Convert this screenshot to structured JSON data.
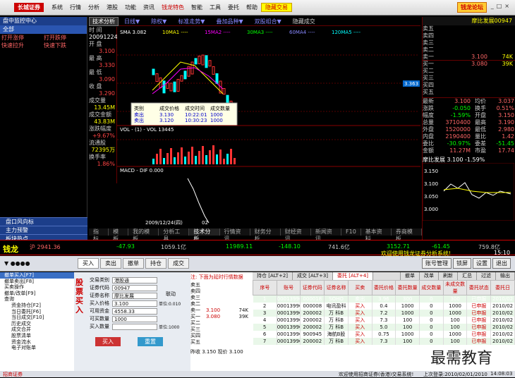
{
  "menu": {
    "logo": "长城证券",
    "items": [
      "系统",
      "行情",
      "分析",
      "港股",
      "功能",
      "资讯",
      "钱龙特色",
      "智能",
      "工具",
      "委托",
      "帮助"
    ],
    "highlight": "隐藏交易",
    "right_btn": "钱龙论坛"
  },
  "left": {
    "header": "盘中监控中心",
    "all": "全部",
    "rows": [
      [
        "打开涨停",
        "打开跌停"
      ],
      [
        "快速拉升",
        "快速下跌"
      ]
    ],
    "sections": [
      "盘口风向标",
      "主力预警",
      "板块热点"
    ]
  },
  "subtab": {
    "title": "技术分析",
    "dropdowns": [
      "日线▼",
      "除权▼",
      "标准走势▼",
      "叠加品种▼",
      "双股组合▼",
      "隐藏成交"
    ]
  },
  "info": {
    "labels": [
      "时 间",
      "开 盘",
      "最 高",
      "最 低",
      "收 盘",
      "成交量",
      "成交金额",
      "涨跌幅度",
      "流通股",
      "换手率"
    ],
    "values": [
      "20091224",
      "3.100",
      "3.330",
      "3.090",
      "3.290",
      "13.45M",
      "43.83M",
      "+9.67%",
      "72395万",
      "1.86%"
    ]
  },
  "chart_data": {
    "type": "line",
    "title": "SMA 3.082",
    "ma_labels": [
      "SMA 3.082",
      "10MA1 ----",
      "15MA2 ----",
      "30MA3 ----",
      "60MA4 ----",
      "120MA5 ----"
    ],
    "y_ticks": [
      "4.000",
      "3.000",
      "2.000",
      "1.000"
    ],
    "vol_title": "VOL - (1) - VOL 13445",
    "vol_ticks": [
      "6000",
      "4000",
      "2000"
    ],
    "macd_title": "MACD - DIF 0.000",
    "macd_ticks": [
      "0.043",
      "0.000",
      "-0.027"
    ],
    "highlight_price": "3.363",
    "tooltip": {
      "headers": [
        "类别",
        "成交价格",
        "成交时间",
        "成交数量"
      ],
      "rows": [
        [
          "卖出",
          "3.130",
          "10:22:01",
          "1000"
        ],
        [
          "卖出",
          "3.120",
          "10:30:23",
          "1000"
        ]
      ]
    },
    "date_label": "2009/12/24(四)",
    "macd_date": "02"
  },
  "bottom_tabs": [
    "指标",
    "模板",
    "我的模板",
    "分析工具",
    "技术分析",
    "行情资讯",
    "财务分析",
    "财经资讯",
    "新闻资讯",
    "F10",
    "基本资料",
    "券商模板"
  ],
  "right": {
    "code": "摩比发展00947",
    "book": [
      [
        "卖五",
        "",
        ""
      ],
      [
        "卖四",
        "",
        ""
      ],
      [
        "卖三",
        "",
        ""
      ],
      [
        "卖二",
        "",
        ""
      ],
      [
        "卖一",
        "3.100",
        "74K"
      ],
      [
        "买一",
        "3.080",
        "39K"
      ],
      [
        "买二",
        "",
        ""
      ],
      [
        "买三",
        "",
        ""
      ],
      [
        "买四",
        "",
        ""
      ],
      [
        "买五",
        "",
        ""
      ]
    ],
    "stats": [
      [
        "最新",
        "3.100",
        "均价",
        "3.037"
      ],
      [
        "涨跌",
        "-0.050",
        "换手",
        "0.51%"
      ],
      [
        "幅度",
        "-1.59%",
        "开盘",
        "3.150"
      ],
      [
        "总量",
        "3710400",
        "最高",
        "3.190"
      ],
      [
        "外盘",
        "1520000",
        "最低",
        "2.980"
      ],
      [
        "内盘",
        "2190400",
        "量比",
        "1.42"
      ],
      [
        "委比",
        "-30.97%",
        "委差",
        "-51.45"
      ],
      [
        "金额",
        "11.27M",
        "市盈",
        "17.74"
      ]
    ],
    "mini_title": "摩比发展 3.100 -1.59%",
    "mini_ticks": [
      "3.150",
      "3.100",
      "3.050",
      "3.000"
    ]
  },
  "ticker": {
    "brand": "钱龙",
    "index": "沪 2941.36",
    "chg": "-47.93",
    "amt": "1059.1亿",
    "sz": "11989.11",
    "szchg": "-148.10",
    "szamt": "741.6亿",
    "sz2": "3152.71",
    "sz2chg": "-61.45",
    "sz2amt": "759.8亿",
    "msg": "欢迎使用钱龙证券分析系统!",
    "time": "15:10"
  },
  "trade": {
    "buttons": [
      "买入",
      "卖出",
      "撤单",
      "持仓",
      "成交"
    ],
    "right_buttons": [
      "账号管理",
      "锁屏",
      "设置",
      "退出"
    ]
  },
  "tree": [
    "撤单买入[F7]",
    "撤单卖出[F8]",
    "买卖操作",
    "撤单/改单[F9]",
    "查询",
    "资金持仓[F2]",
    "当日委托[F6]",
    "当日成交[F10]",
    "历史成交",
    "成交合并",
    "股票清单",
    "资金流水",
    "电子对账单"
  ],
  "form": {
    "side_label": "股票买入",
    "labels": [
      "交易类别",
      "证券代码",
      "证券名称",
      "买入价格",
      "可用资金",
      "可买数量",
      "买入数量"
    ],
    "values": [
      "港股通",
      "00947",
      "摩比发展",
      "3.100",
      "4558.33",
      "1000",
      ""
    ],
    "buy": "买入",
    "reset": "重置",
    "unit": "单位:0.010",
    "unit2": "单位:1000",
    "link": "联动"
  },
  "mini": {
    "title": "注: 下面为延时行情数据",
    "rows": [
      [
        "卖五",
        "",
        ""
      ],
      [
        "卖四",
        "",
        ""
      ],
      [
        "卖三",
        "",
        ""
      ],
      [
        "卖二",
        "",
        ""
      ],
      [
        "卖一",
        "3.100",
        "74K"
      ],
      [
        "买一",
        "3.080",
        "39K"
      ],
      [
        "买二",
        "",
        ""
      ],
      [
        "买三",
        "",
        ""
      ],
      [
        "买四",
        "",
        ""
      ],
      [
        "买五",
        "",
        ""
      ]
    ],
    "foot": "昨收 3.150  现价 3.100"
  },
  "orders": {
    "tabs": [
      "持仓 [ALT+2]",
      "成交 [ALT+3]",
      "委托 [ALT+4]"
    ],
    "actions": [
      "撤单",
      "改单",
      "刷新",
      "汇总",
      "过滤",
      "输出"
    ],
    "headers": [
      "序号",
      "账号",
      "证券代码",
      "证券名称",
      "买卖",
      "委托价格",
      "委托数量",
      "成交数量",
      "未成交数量",
      "委托状态",
      "委托日"
    ],
    "rows": [
      [
        "1",
        "00013996",
        "000018",
        "SOHO",
        "卖出",
        "3.96",
        "300",
        "0",
        "300",
        "已申报",
        "2010/02"
      ],
      [
        "2",
        "00013996",
        "000008",
        "电讯盈科",
        "买入",
        "0.4",
        "1000",
        "0",
        "1000",
        "已申报",
        "2010/02"
      ],
      [
        "3",
        "00013996",
        "200002",
        "万 科B",
        "买入",
        "7.2",
        "1000",
        "0",
        "1000",
        "已申报",
        "2010/02"
      ],
      [
        "4",
        "00013996",
        "200002",
        "万 科B",
        "买入",
        "7.3",
        "100",
        "0",
        "100",
        "已申报",
        "2010/02"
      ],
      [
        "5",
        "00013996",
        "200002",
        "万 科B",
        "买入",
        "5.0",
        "100",
        "0",
        "100",
        "已申报",
        "2010/02"
      ],
      [
        "6",
        "00013996",
        "900945",
        "海航B股",
        "买入",
        "0.75",
        "1000",
        "0",
        "1000",
        "已申报",
        "2010/02"
      ],
      [
        "7",
        "00013996",
        "200002",
        "万 科B",
        "买入",
        "7.3",
        "100",
        "0",
        "100",
        "已申报",
        "2010/02"
      ]
    ]
  },
  "watermark": "最需教育",
  "status": {
    "brand": "招商证券",
    "msg": "欢迎使用招商证券(香港)交易系统!",
    "login": "上次登录:2010/02/01/2010",
    "time": "14:08:03"
  }
}
